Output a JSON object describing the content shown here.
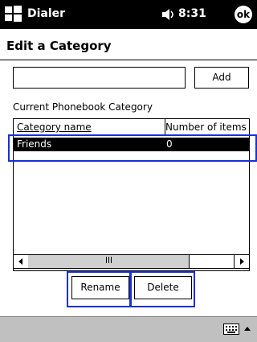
{
  "titlebar": {
    "app_title": "Dialer",
    "time": "8:31",
    "ok_label": "ok"
  },
  "page": {
    "title": "Edit a Category"
  },
  "form": {
    "name_value": "",
    "add_label": "Add"
  },
  "section": {
    "label": "Current Phonebook Category"
  },
  "list": {
    "columns": [
      "Category name",
      "Number of items"
    ],
    "rows": [
      {
        "name": "Friends",
        "count": "0"
      }
    ]
  },
  "actions": {
    "rename_label": "Rename",
    "delete_label": "Delete"
  }
}
